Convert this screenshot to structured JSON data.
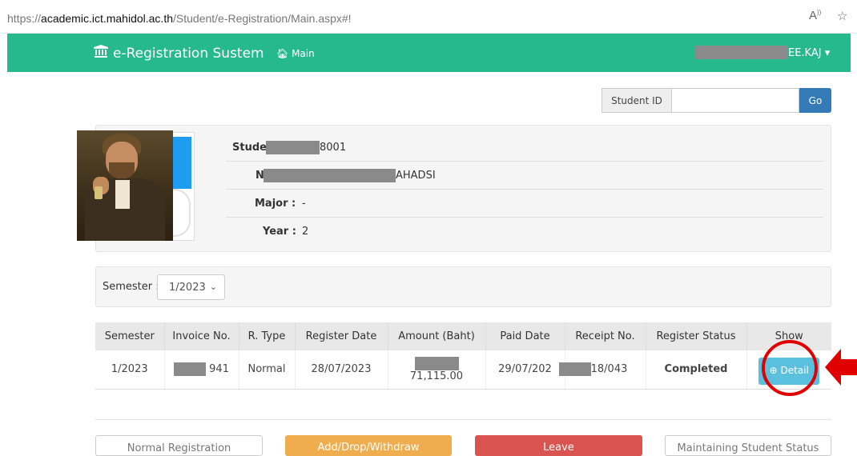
{
  "browser": {
    "url_prefix": "https://",
    "url_host": "academic.ict.mahidol.ac.th",
    "url_path": "/Student/e-Registration/Main.aspx#!"
  },
  "navbar": {
    "brand": "e-Registration Sustem",
    "main_link": "Main",
    "user_name": "EE.KAJ ▾"
  },
  "search": {
    "label": "Student ID",
    "value": "",
    "go_label": "Go"
  },
  "student": {
    "id_label": "Studer",
    "id_value": "8001",
    "name_label": "N",
    "name_value": "AHADSI",
    "major_label": "Major :",
    "major_value": "-",
    "year_label": "Year :",
    "year_value": "2"
  },
  "semester": {
    "label": "Semester :",
    "selected": "1/2023"
  },
  "table": {
    "headers": [
      "Semester",
      "Invoice No.",
      "R. Type",
      "Register Date",
      "Amount (Baht)",
      "Paid Date",
      "Receipt No.",
      "Register Status",
      "Show"
    ],
    "row": {
      "semester": "1/2023",
      "invoice": "941",
      "rtype": "Normal",
      "register_date": "28/07/2023",
      "amount": "71,115.00",
      "paid_date": "29/07/202",
      "receipt": "18/043",
      "status": "Completed",
      "detail_label": "Detail"
    }
  },
  "actions": {
    "normal": "Normal Registration",
    "add_drop": "Add/Drop/Withdraw",
    "leave": "Leave",
    "maintain": "Maintaining Student Status"
  },
  "colors": {
    "navbar": "#27b98e",
    "go_button": "#337ab7",
    "detail_button": "#5bc0de",
    "completed": "#1e7e1e",
    "add_drop": "#f0ad4e",
    "leave": "#d9534f",
    "highlight": "#e00000"
  }
}
